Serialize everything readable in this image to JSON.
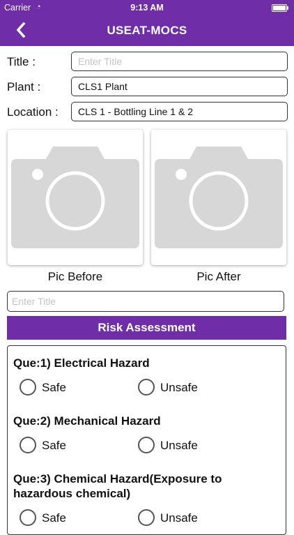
{
  "status": {
    "carrier": "Carrier",
    "time": "9:13 AM"
  },
  "nav": {
    "back_icon": "chevron-left-icon",
    "title": "USEAT-MOCS"
  },
  "form": {
    "title_label": "Title :",
    "title_placeholder": "Enter Title",
    "plant_label": "Plant :",
    "plant_value": "CLS1 Plant",
    "location_label": "Location :",
    "location_value": "CLS 1 - Bottling Line 1 & 2"
  },
  "pics": {
    "before_label": "Pic Before",
    "after_label": "Pic After",
    "icon": "camera-icon"
  },
  "second_title_placeholder": "Enter Title",
  "risk": {
    "header": "Risk Assessment",
    "questions": [
      {
        "text": "Que:1) Electrical Hazard",
        "safe": "Safe",
        "unsafe": "Unsafe"
      },
      {
        "text": "Que:2) Mechanical Hazard",
        "safe": "Safe",
        "unsafe": "Unsafe"
      },
      {
        "text": "Que:3) Chemical Hazard(Exposure to hazardous chemical)",
        "safe": "Safe",
        "unsafe": "Unsafe"
      }
    ]
  },
  "colors": {
    "primary": "#6f2da8",
    "camera_gray": "#d7d7d7"
  }
}
